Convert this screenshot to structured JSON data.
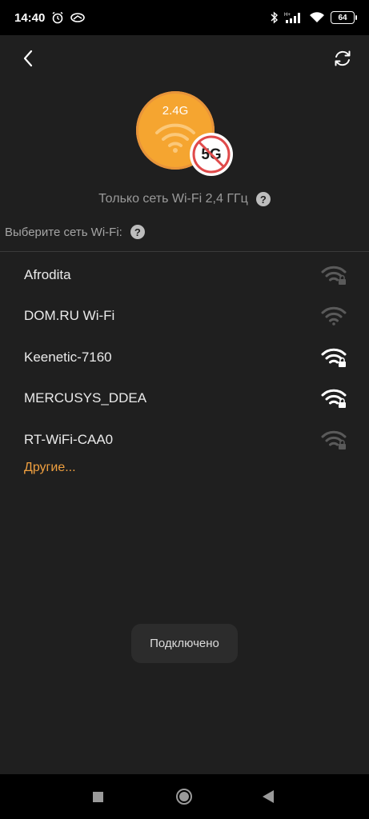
{
  "status_bar": {
    "time": "14:40",
    "battery": "64",
    "network_badge": "H+"
  },
  "header": {
    "back_icon": "chevron-left-icon",
    "refresh_icon": "refresh-icon"
  },
  "hero": {
    "band_24": "2.4G",
    "band_5": "5G",
    "accent_color": "#f5a530",
    "disabled_color": "#e53935"
  },
  "only_24_text": "Только сеть Wi-Fi 2,4 ГГц",
  "choose_label": "Выберите сеть Wi-Fi:",
  "help_symbol": "?",
  "networks": [
    {
      "name": "Afrodita",
      "strength": "weak",
      "locked": true
    },
    {
      "name": "DOM.RU Wi-Fi",
      "strength": "weak",
      "locked": false
    },
    {
      "name": "Keenetic-7160",
      "strength": "strong",
      "locked": true
    },
    {
      "name": "MERCUSYS_DDEA",
      "strength": "strong",
      "locked": true
    },
    {
      "name": "RT-WiFi-CAA0",
      "strength": "weak",
      "locked": true
    }
  ],
  "others_link": "Другие...",
  "toast": "Подключено"
}
